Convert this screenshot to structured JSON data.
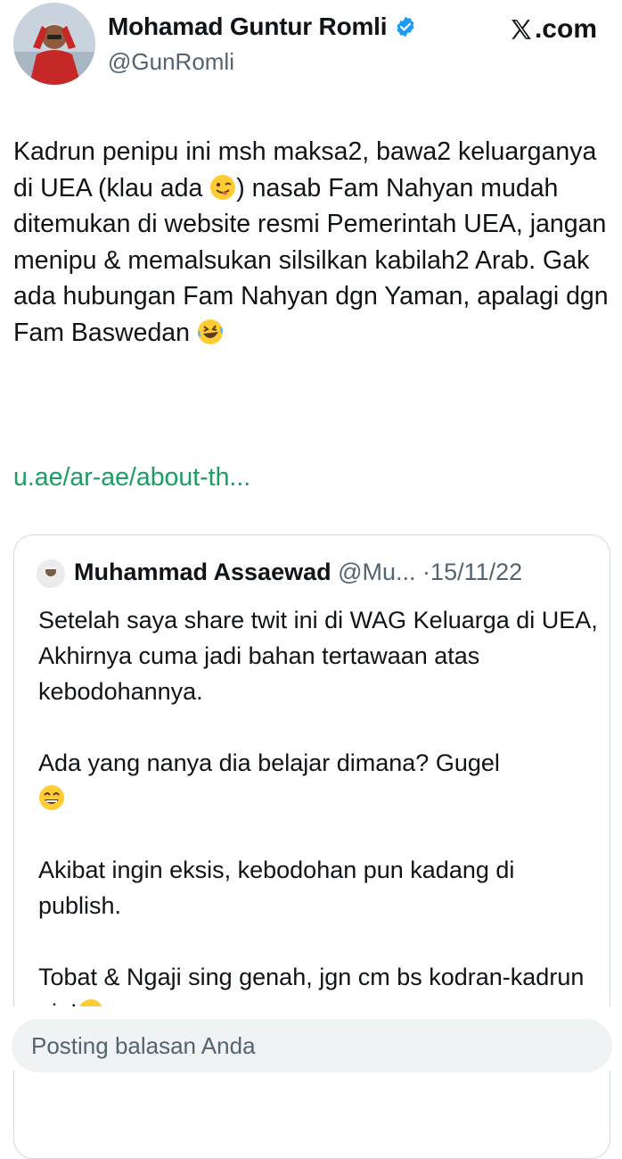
{
  "author": {
    "name": "Mohamad Guntur Romli",
    "handle": "@GunRomli",
    "verified": true
  },
  "brand": {
    "label": ".com",
    "icon": "x-logo-icon"
  },
  "tweet": {
    "text_part1": "Kadrun penipu ini msh maksa2, bawa2 keluarganya di UEA (klau ada ",
    "emoji1": "winking-face-with-tongue",
    "text_part2": ") nasab Fam Nahyan mudah ditemukan di website resmi Pemerintah UEA, jangan menipu & memalsukan silsilkan kabilah2 Arab. Gak ada hubungan Fam Nahyan dgn Yaman, apalagi dgn Fam Baswedan ",
    "emoji2": "rolling-on-the-floor-laughing",
    "link": "u.ae/ar-ae/about-th..."
  },
  "quote": {
    "name": "Muhammad Assaewad",
    "handle": "@Mu...",
    "separator": "·",
    "date": "15/11/22",
    "paragraph1": "Setelah saya share twit ini di WAG Keluarga di UEA, Akhirnya cuma jadi bahan tertawaan atas kebodohannya.",
    "paragraph2": "Ada yang nanya dia belajar dimana? Gugel",
    "emoji3": "grinning-face-with-smiling-eyes",
    "paragraph3": "Akibat ingin eksis, kebodohan pun kadang di publish.",
    "paragraph4": "Tobat & Ngaji sing genah, jgn cm bs kodran-kadrun aja!",
    "emoji4": "grinning-face"
  },
  "reply": {
    "placeholder": "Posting balasan Anda"
  },
  "colors": {
    "link": "#1b9d63",
    "verified": "#1d9bf0",
    "secondary_text": "#536471",
    "border": "#cfd9de",
    "reply_bg": "#eff3f4"
  }
}
